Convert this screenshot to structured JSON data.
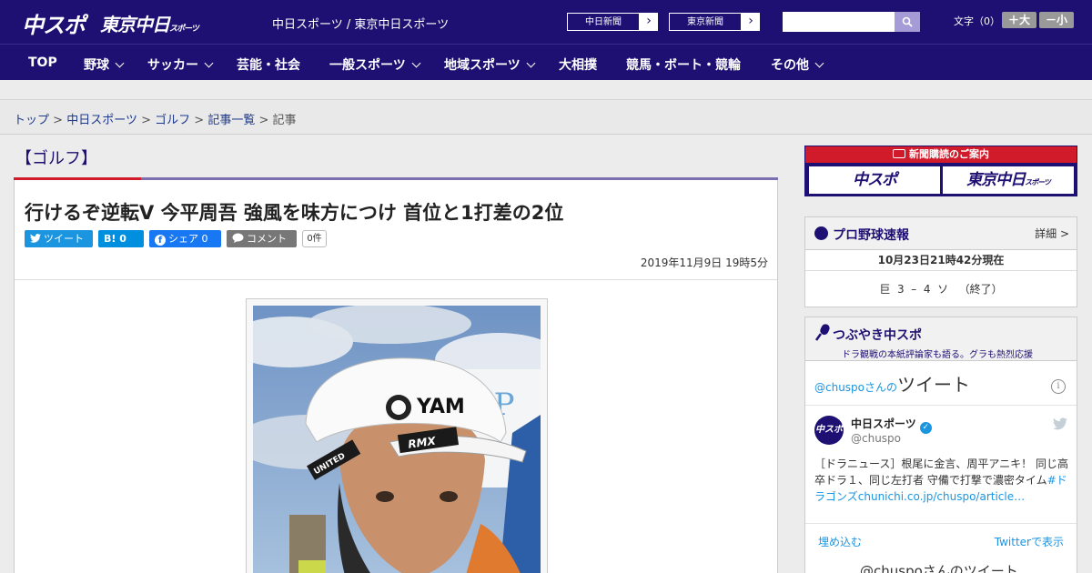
{
  "header": {
    "logo_chuspo": "中スポ",
    "logo_tokyo": "東京中日",
    "logo_tokyo_small": "スポーツ",
    "site_names": "中日スポーツ / 東京中日スポーツ",
    "ext_links": [
      "中日新聞",
      "東京新聞"
    ],
    "font_label": "文字（0）",
    "font_bigger": "＋大",
    "font_smaller": "－小"
  },
  "nav": {
    "items": [
      {
        "label": "TOP",
        "dropdown": false
      },
      {
        "label": "野球",
        "dropdown": true
      },
      {
        "label": "サッカー",
        "dropdown": true
      },
      {
        "label": "芸能・社会",
        "dropdown": false
      },
      {
        "label": "一般スポーツ",
        "dropdown": true
      },
      {
        "label": "地域スポーツ",
        "dropdown": true
      },
      {
        "label": "大相撲",
        "dropdown": false
      },
      {
        "label": "競馬・ボート・競輪",
        "dropdown": false
      },
      {
        "label": "その他",
        "dropdown": true
      }
    ]
  },
  "breadcrumb": {
    "links": [
      "トップ",
      "中日スポーツ",
      "ゴルフ",
      "記事一覧"
    ],
    "separator": ">",
    "current": "記事"
  },
  "article": {
    "category": "【ゴルフ】",
    "headline": "行けるぞ逆転V 今平周吾 強風を味方につけ 首位と1打差の2位",
    "share": {
      "tweet": "ツイート",
      "hatena": "B! 0",
      "facebook": "シェア 0",
      "comment": "コメント",
      "comment_count": "0件"
    },
    "date": "2019年11月9日 19時5分",
    "photo_text": {
      "cap_brand": "YAM",
      "cap_side": "UNITED",
      "cap_front": "RMX"
    }
  },
  "sidebar": {
    "promo": {
      "heading": "新聞購読のご案内",
      "chuspo": "中スポ",
      "tokyo": "東京中日",
      "tokyo_small": "スポーツ"
    },
    "baseball": {
      "title": "プロ野球速報",
      "detail": "詳細 >",
      "as_of": "10月23日21時42分現在",
      "score": "巨  3  –  4  ソ   （終了）"
    },
    "tsubuyaki": {
      "title": "つぶやき中スポ",
      "subtitle": "ドラ観戦の本紙評論家も語る。グラも熱烈応援",
      "tweets_head_small": "@chuspoさんの",
      "tweets_head_big": "ツイート",
      "account_name": "中日スポーツ",
      "account_handle": "@chuspo",
      "avatar_text": "中スポ",
      "tweet_text": "［ドラニュース］根尾に金言、周平アニキ！ 同じ高卒ドラ１、同じ左打者 守備で打撃で濃密タイム",
      "tweet_link": "#ドラゴンズchunichi.co.jp/chuspo/article…",
      "embed": "埋め込む",
      "view_on_twitter": "Twitterで表示",
      "footer": "@chuspoさんのツイート"
    }
  },
  "colors": {
    "brand_navy": "#1e0f72",
    "accent_red": "#d11a2a",
    "twitter_blue": "#1b95e0",
    "facebook_blue": "#1877f2"
  }
}
